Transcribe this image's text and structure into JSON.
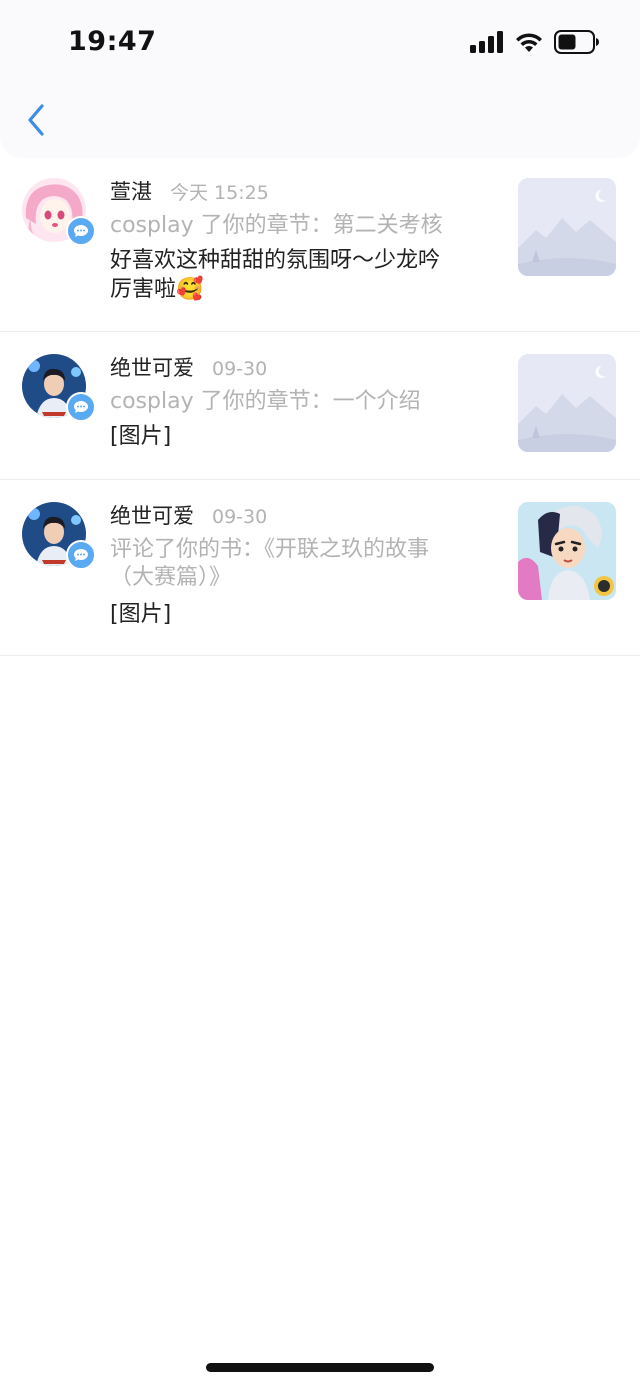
{
  "status_bar": {
    "time": "19:47",
    "icons": [
      "cellular-signal-icon",
      "wifi-icon",
      "battery-icon"
    ]
  },
  "nav": {
    "back_icon": "chevron-left-icon"
  },
  "colors": {
    "accent": "#3a8ee6",
    "badge": "#5aa9f3",
    "secondary_text": "#b3b3b3",
    "divider": "#ececec"
  },
  "messages": [
    {
      "name": "萱湛",
      "time": "今天 15:25",
      "subtitle": "cosplay 了你的章节：第二关考核",
      "body_line1": "好喜欢这种甜甜的氛围呀～少龙吟",
      "body_line2": "厉害啦🥰",
      "badge_icon": "comment-bubble-icon",
      "thumbnail": "placeholder-landscape-image"
    },
    {
      "name": "绝世可爱",
      "time": "09-30",
      "subtitle": "cosplay 了你的章节：一个介绍",
      "body_line1": "[图片]",
      "badge_icon": "comment-bubble-icon",
      "thumbnail": "placeholder-landscape-image"
    },
    {
      "name": "绝世可爱",
      "time": "09-30",
      "subtitle_line1": "评论了你的书：《开联之玖的故事",
      "subtitle_line2": "（大赛篇）》",
      "body_line1": "[图片]",
      "badge_icon": "comment-bubble-icon",
      "thumbnail": "book-cover-image"
    }
  ]
}
